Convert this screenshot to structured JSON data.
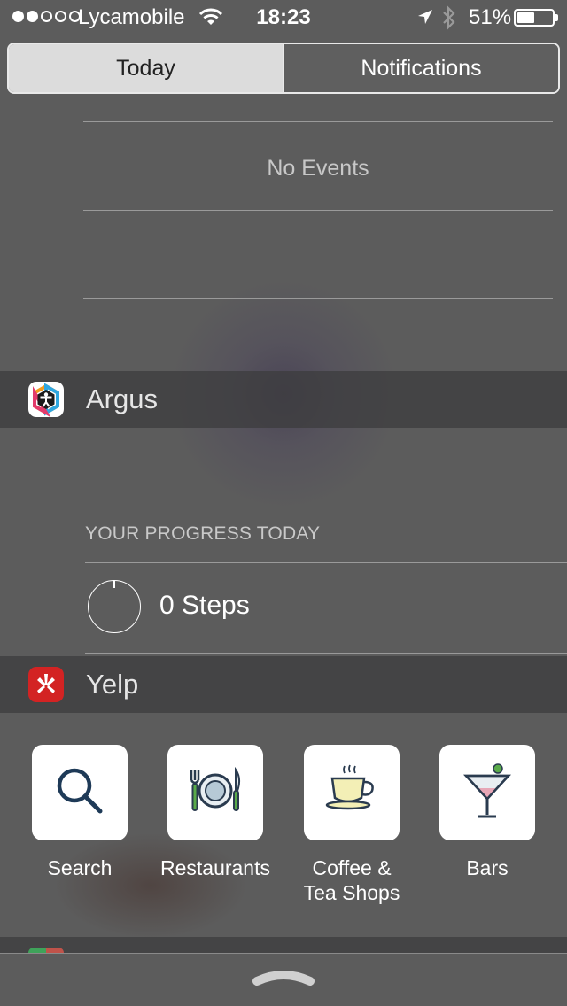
{
  "status_bar": {
    "carrier": "Lycamobile",
    "time": "18:23",
    "battery_percent": "51%",
    "battery_level": 0.51,
    "signal_filled": 2,
    "signal_total": 5,
    "icons": [
      "wifi-icon",
      "location-arrow-icon",
      "bluetooth-icon",
      "battery-icon"
    ]
  },
  "segmented": {
    "tabs": [
      {
        "label": "Today",
        "selected": true
      },
      {
        "label": "Notifications",
        "selected": false
      }
    ]
  },
  "calendar": {
    "empty_text": "No Events"
  },
  "argus": {
    "app_name": "Argus",
    "icon": "argus-person-icon",
    "progress_title": "YOUR PROGRESS TODAY",
    "steps_label": "0 Steps",
    "steps_value": 0
  },
  "yelp": {
    "app_name": "Yelp",
    "icon": "yelp-burst-icon",
    "tiles": [
      {
        "label": "Search",
        "icon": "search-icon"
      },
      {
        "label": "Restaurants",
        "icon": "plate-fork-knife-icon"
      },
      {
        "label": "Coffee & Tea Shops",
        "icon": "coffee-cup-icon"
      },
      {
        "label": "Bars",
        "icon": "martini-glass-icon"
      }
    ]
  },
  "colors": {
    "yelp_red": "#d32323",
    "segment_active_bg": "#dcdcdc"
  }
}
